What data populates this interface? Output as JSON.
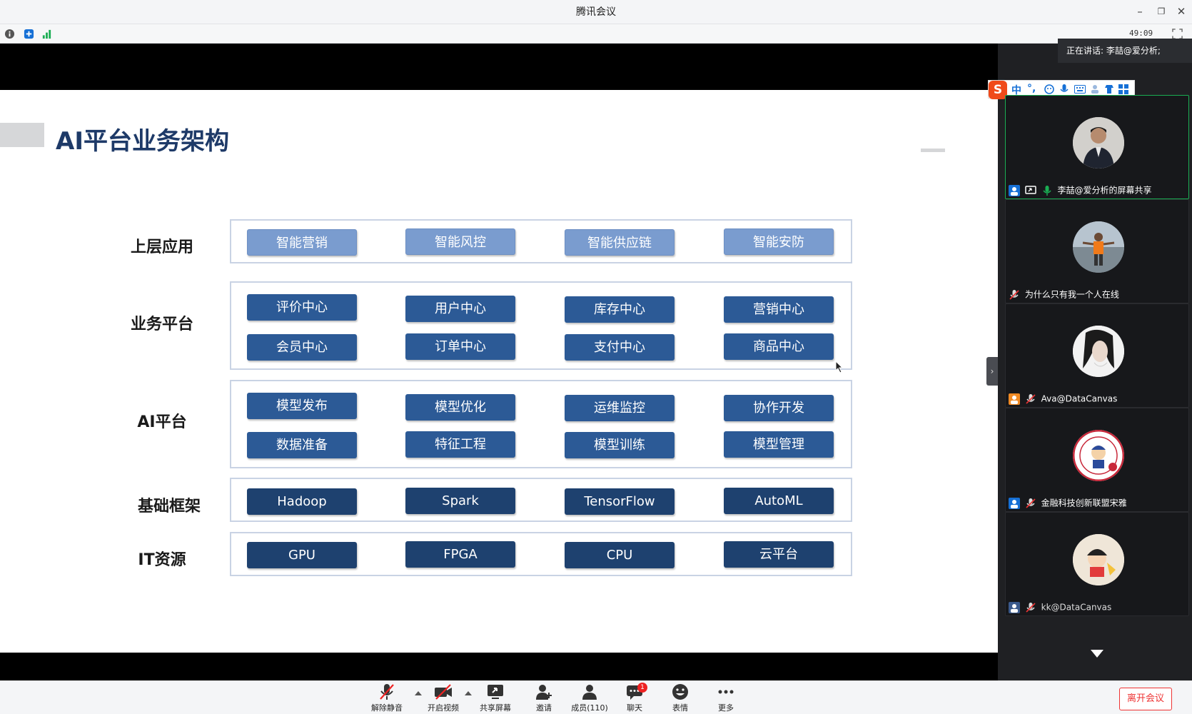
{
  "window": {
    "title": "腾讯会议"
  },
  "infobar": {
    "timer": "49:09"
  },
  "speaking": {
    "text": "正在讲话: 李喆@爱分析;"
  },
  "ime": {
    "items": [
      "中",
      "°,"
    ]
  },
  "slide": {
    "title": "AI平台业务架构",
    "rows": [
      {
        "label": "上层应用",
        "chips": [
          [
            "智能营销",
            "智能风控",
            "智能供应链",
            "智能安防"
          ]
        ]
      },
      {
        "label": "业务平台",
        "chips": [
          [
            "评价中心",
            "用户中心",
            "库存中心",
            "营销中心"
          ],
          [
            "会员中心",
            "订单中心",
            "支付中心",
            "商品中心"
          ]
        ]
      },
      {
        "label": "AI平台",
        "chips": [
          [
            "模型发布",
            "模型优化",
            "运维监控",
            "协作开发"
          ],
          [
            "数据准备",
            "特征工程",
            "模型训练",
            "模型管理"
          ]
        ]
      },
      {
        "label": "基础框架",
        "chips": [
          [
            "Hadoop",
            "Spark",
            "TensorFlow",
            "AutoML"
          ]
        ]
      },
      {
        "label": "IT资源",
        "chips": [
          [
            "GPU",
            "FPGA",
            "CPU",
            "云平台"
          ]
        ]
      }
    ]
  },
  "participants": [
    {
      "name": "李喆@爱分析的屏幕共享"
    },
    {
      "name": "为什么只有我一个人在线"
    },
    {
      "name": "Ava@DataCanvas"
    },
    {
      "name": "金融科技创新联盟宋雅"
    },
    {
      "name": "kk@DataCanvas"
    }
  ],
  "toolbar": {
    "unmute": "解除静音",
    "video": "开启视频",
    "share": "共享屏幕",
    "invite": "邀请",
    "members": "成员(110)",
    "chat": "聊天",
    "chat_badge": "1",
    "emoji": "表情",
    "more": "更多",
    "leave": "离开会议"
  },
  "colors": {
    "accent": "#1aad53",
    "danger": "#e22222",
    "chip_dark": "#1e416f",
    "chip_light": "#7a9ccf"
  }
}
